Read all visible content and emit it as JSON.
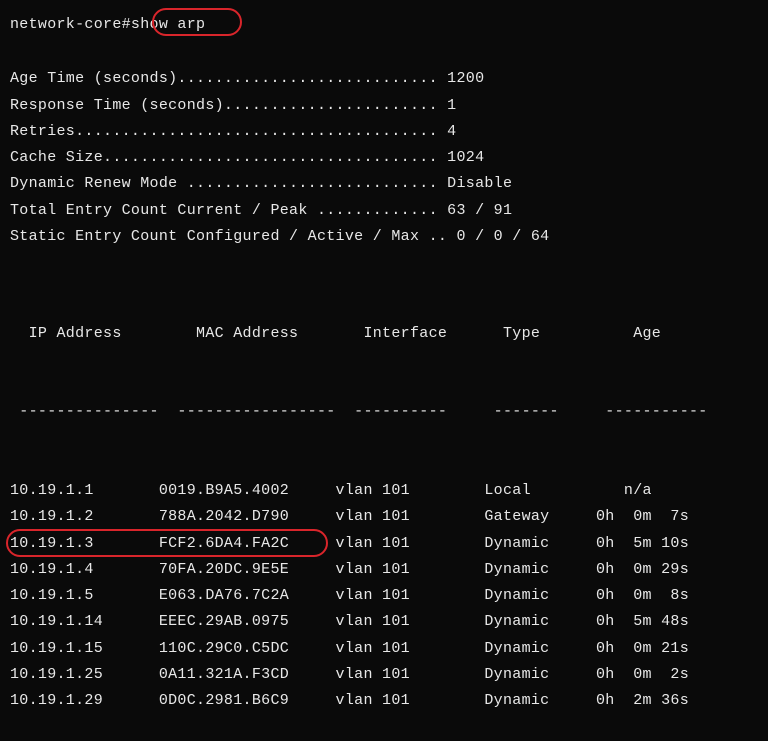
{
  "prompt": {
    "host": "network-core#",
    "command": "show arp"
  },
  "settings": [
    {
      "label": "Age Time (seconds)",
      "dots": "............................",
      "value": "1200"
    },
    {
      "label": "Response Time (seconds)",
      "dots": ".......................",
      "value": "1"
    },
    {
      "label": "Retries",
      "dots": ".......................................",
      "value": "4"
    },
    {
      "label": "Cache Size",
      "dots": "....................................",
      "value": "1024"
    },
    {
      "label": "Dynamic Renew Mode ",
      "dots": "...........................",
      "value": "Disable"
    },
    {
      "label": "Total Entry Count Current / Peak ",
      "dots": ".............",
      "value": "63 / 91"
    },
    {
      "label": "Static Entry Count Configured / Active / Max ",
      "dots": "..",
      "value": "0 / 0 / 64"
    }
  ],
  "table": {
    "headers": {
      "ip": "IP Address",
      "mac": "MAC Address",
      "iface": "Interface",
      "type": "Type",
      "age": "Age"
    },
    "underline": {
      "ip": "---------------",
      "mac": "-----------------",
      "iface": "----------",
      "type": "-------",
      "age": "-----------"
    },
    "rows": [
      {
        "ip": "10.19.1.1",
        "mac": "0019.B9A5.4002",
        "iface": "vlan 101",
        "type": "Local",
        "age": "    n/a",
        "hl": false
      },
      {
        "ip": "10.19.1.2",
        "mac": "788A.2042.D790",
        "iface": "vlan 101",
        "type": "Gateway",
        "age": " 0h  0m  7s",
        "hl": false
      },
      {
        "ip": "10.19.1.3",
        "mac": "FCF2.6DA4.FA2C",
        "iface": "vlan 101",
        "type": "Dynamic",
        "age": " 0h  5m 10s",
        "hl": true
      },
      {
        "ip": "10.19.1.4",
        "mac": "70FA.20DC.9E5E",
        "iface": "vlan 101",
        "type": "Dynamic",
        "age": " 0h  0m 29s",
        "hl": false
      },
      {
        "ip": "10.19.1.5",
        "mac": "E063.DA76.7C2A",
        "iface": "vlan 101",
        "type": "Dynamic",
        "age": " 0h  0m  8s",
        "hl": false
      },
      {
        "ip": "10.19.1.14",
        "mac": "EEEC.29AB.0975",
        "iface": "vlan 101",
        "type": "Dynamic",
        "age": " 0h  5m 48s",
        "hl": false
      },
      {
        "ip": "10.19.1.15",
        "mac": "110C.29C0.C5DC",
        "iface": "vlan 101",
        "type": "Dynamic",
        "age": " 0h  0m 21s",
        "hl": false
      },
      {
        "ip": "10.19.1.25",
        "mac": "0A11.321A.F3CD",
        "iface": "vlan 101",
        "type": "Dynamic",
        "age": " 0h  0m  2s",
        "hl": false
      },
      {
        "ip": "10.19.1.29",
        "mac": "0D0C.2981.B6C9",
        "iface": "vlan 101",
        "type": "Dynamic",
        "age": " 0h  2m 36s",
        "hl": false
      }
    ]
  }
}
